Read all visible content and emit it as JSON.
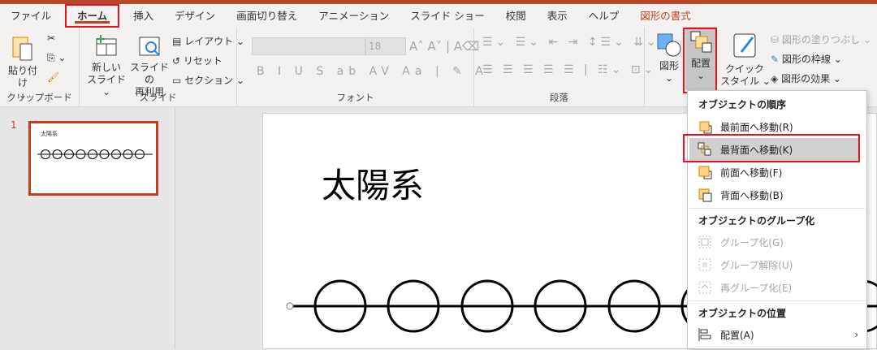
{
  "tabs": [
    "ファイル",
    "ホーム",
    "挿入",
    "デザイン",
    "画面切り替え",
    "アニメーション",
    "スライド ショー",
    "校閲",
    "表示",
    "ヘルプ",
    "図形の書式"
  ],
  "active_tab": "ホーム",
  "clipboard": {
    "paste": "貼り付け",
    "label": "クリップボード"
  },
  "slides_group": {
    "new_slide_1": "新しい",
    "new_slide_2": "スライド",
    "reuse_1": "スライドの",
    "reuse_2": "再利用",
    "layout": "レイアウト",
    "reset": "リセット",
    "section": "セクション",
    "label": "スライド"
  },
  "font": {
    "font_name": "",
    "font_size": "18",
    "label": "フォント"
  },
  "paragraph": {
    "label": "段落"
  },
  "drawing": {
    "shapes": "図形",
    "arrange": "配置",
    "quick_style_1": "クイック",
    "quick_style_2": "スタイル",
    "fill": "図形の塗りつぶし",
    "outline": "図形の枠線",
    "effects": "図形の効果"
  },
  "thumbnail": {
    "number": "1",
    "title": "太陽系"
  },
  "slide": {
    "title": "太陽系"
  },
  "menu": {
    "h1": "オブジェクトの順序",
    "bring_front": "最前面へ移動(R)",
    "send_back": "最背面へ移動(K)",
    "forward": "前面へ移動(F)",
    "backward": "背面へ移動(B)",
    "h2": "オブジェクトのグループ化",
    "group": "グループ化(G)",
    "ungroup": "グループ解除(U)",
    "regroup": "再グループ化(E)",
    "h3": "オブジェクトの位置",
    "align": "配置(A)"
  },
  "colors": {
    "accent": "#b7472a",
    "highlight": "#e81123",
    "selected": "#d2d0ce"
  }
}
